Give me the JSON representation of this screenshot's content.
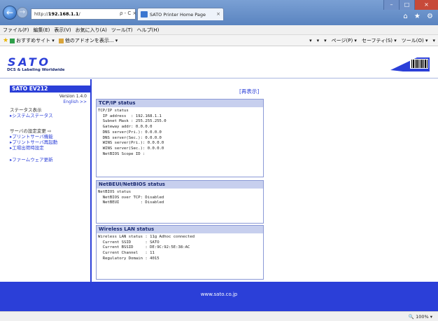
{
  "browser": {
    "address": "http://192.168.1.1/",
    "address_prefix": "http://",
    "address_domain": "192.168.1.1",
    "address_suffix": "/",
    "address_buttons": "ρ - C ×",
    "tab_title": "SATO Printer Home Page",
    "tab_close": "×",
    "window_buttons": [
      "–",
      "□",
      "×"
    ],
    "title_icons": "⌂ ★ ⚙"
  },
  "menu": [
    "ファイル(F)",
    "編集(E)",
    "表示(V)",
    "お気に入り(A)",
    "ツール(T)",
    "ヘルプ(H)"
  ],
  "favorites": {
    "suggested": "おすすめサイト ▾",
    "addons": "他のアドオンを表示... ▾",
    "right_tools": [
      "▾",
      "▾",
      "▾",
      "ページ(P) ▾",
      "セーフティ(S) ▾",
      "ツール(O) ▾",
      "▾"
    ]
  },
  "header": {
    "logo_text": "SATO",
    "tagline": "DCS & Labeling Worldwide"
  },
  "sidebar": {
    "title": "SATO EV212",
    "version": "Version 1.4.0",
    "english": "English >>",
    "status_heading": "ステータス表示",
    "system_status": "▸システムステータス",
    "settings_heading": "サーバの設定変更 ⇨",
    "print_server_func": "▸プリントサーバ機能",
    "print_server_restart": "▸プリントサーバ再起動",
    "factory_default": "▸工場出荷時設定",
    "firmware_update": "▸ファームウェア更新"
  },
  "content": {
    "refresh": "[再表示]",
    "tcpip": {
      "title": "TCP/IP status",
      "lines": "TCP/IP status\n  IP address  : 192.168.1.1\n  Subnet Mask : 255.255.255.0\n  Gateway addr: 0.0.0.0\n  DNS server(Pri.): 0.0.0.0\n  DNS server(Sec.): 0.0.0.0\n  WINS server(Pri.): 0.0.0.0\n  WINS server(Sec.): 0.0.0.0\n  NetBIOS Scope ID :"
    },
    "netbeui": {
      "title": "NetBEUI/NetBIOS status",
      "lines": "NetBIOS status\n  NetBIOS over TCP: Disabled\n  NetBEUI         : Disabled"
    },
    "wlan": {
      "title": "Wireless LAN status",
      "lines": "Wireless LAN status : 11g Adhoc connected\n  Current SSID      : SATO\n  Current BSSID     : DE:9C:92:5E:38:AC\n  Current Channel   : 11\n  Regulatory Domain : 4015"
    }
  },
  "footer": {
    "url": "www.sato.co.jp"
  },
  "status": {
    "zoom": "100%  ▾"
  },
  "colors": {
    "brand_blue": "#2b3fd8",
    "box_header": "#c7cfee",
    "logo_blue": "#2b3fd8"
  }
}
